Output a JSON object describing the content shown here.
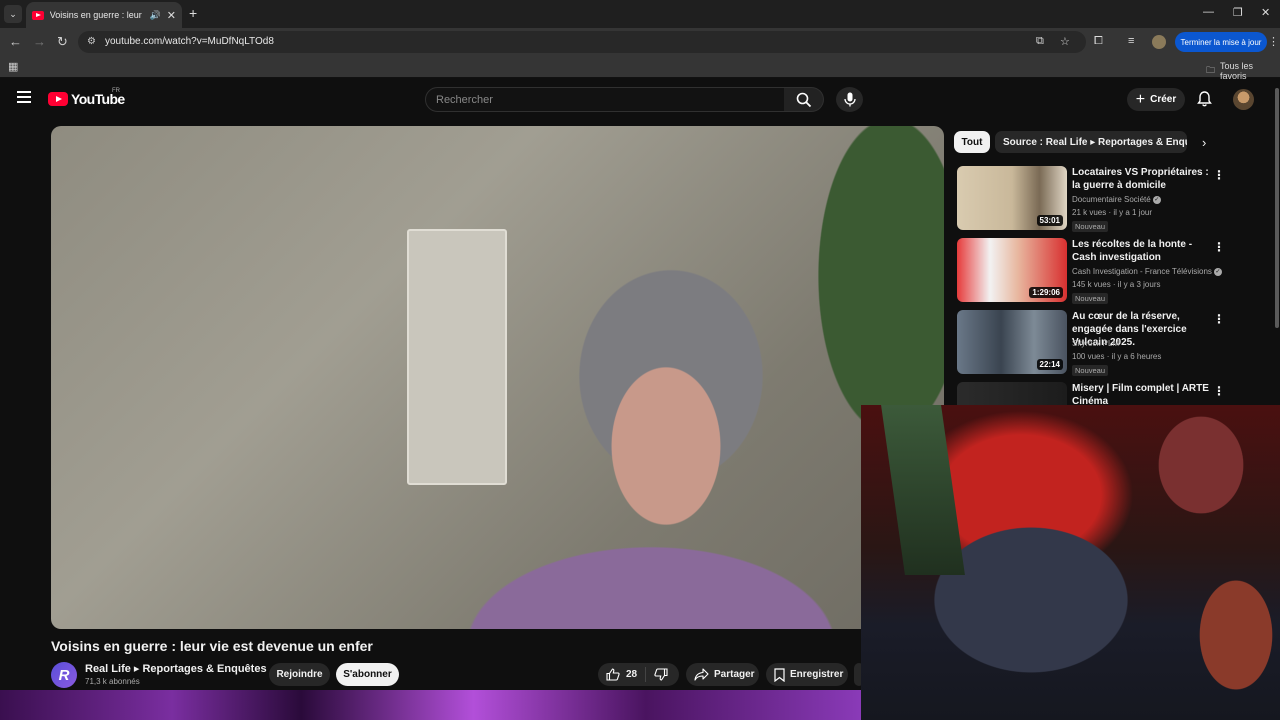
{
  "browser": {
    "tab_title": "Voisins en guerre : leur vie",
    "url": "youtube.com/watch?v=MuDfNqLTOd8",
    "update_button": "Terminer la mise à jour",
    "all_bookmarks": "Tous les favoris"
  },
  "header": {
    "logo_text": "YouTube",
    "region": "FR",
    "search_placeholder": "Rechercher",
    "create_label": "Créer"
  },
  "video": {
    "title": "Voisins en guerre : leur vie est devenue un enfer",
    "channel_name": "Real Life ▸ Reportages & Enquêtes",
    "channel_initial": "R",
    "subscribers": "71,3 k abonnés",
    "join_label": "Rejoindre",
    "subscribe_label": "S'abonner",
    "likes": "28",
    "share_label": "Partager",
    "save_label": "Enregistrer"
  },
  "sidebar": {
    "chips": [
      "Tout",
      "Source : Real Life ▸ Reportages & Enquêtes"
    ],
    "recommendations": [
      {
        "title": "Locataires VS Propriétaires : la guerre à domicile",
        "channel": "Documentaire Société",
        "verified": true,
        "meta": "21 k vues · il y a 1 jour",
        "badge": "Nouveau",
        "duration": "53:01"
      },
      {
        "title": "Les récoltes de la honte - Cash investigation",
        "channel": "Cash Investigation - France Télévisions",
        "verified": true,
        "meta": "145 k vues · il y a 3 jours",
        "badge": "Nouveau",
        "duration": "1:29:06"
      },
      {
        "title": "Au cœur de la réserve, engagée dans l'exercice Vulcain 2025.",
        "channel": "Skyrock PLM",
        "verified": false,
        "meta": "100 vues · il y a 6 heures",
        "badge": "Nouveau",
        "duration": "22:14"
      },
      {
        "title": "Misery | Film complet | ARTE Cinéma",
        "channel": "",
        "verified": false,
        "meta": "",
        "badge": "",
        "duration": ""
      }
    ]
  },
  "colors": {
    "youtube_red": "#ff0033",
    "background": "#0f0f0f",
    "chip_active": "#f1f1f1",
    "update_blue": "#0b57d0"
  }
}
